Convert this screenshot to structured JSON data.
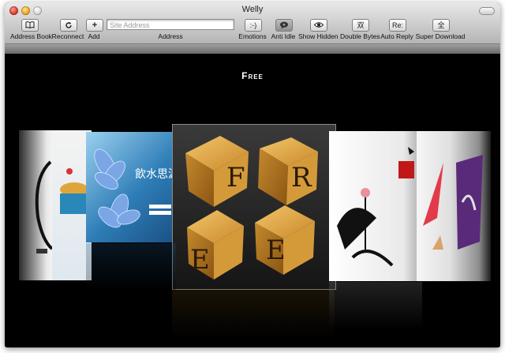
{
  "window": {
    "title": "Welly"
  },
  "toolbar": {
    "address_book": {
      "label": "Address Book",
      "icon": "book-icon"
    },
    "reconnect": {
      "label": "Reconnect",
      "icon": "reload-icon"
    },
    "add": {
      "label": "Add",
      "glyph": "+"
    },
    "address": {
      "label": "Address",
      "placeholder": "Site Address"
    },
    "emotions": {
      "label": "Emotions",
      "glyph": ":-)"
    },
    "anti_idle": {
      "label": "Anti Idle",
      "icon": "speech-bubble-icon"
    },
    "show_hidden": {
      "label": "Show Hidden",
      "icon": "eye-icon"
    },
    "double_bytes": {
      "label": "Double Bytes",
      "glyph": "双"
    },
    "auto_reply": {
      "label": "Auto Reply",
      "glyph": "Re:"
    },
    "super_download": {
      "label": "Super Download",
      "glyph": "全"
    }
  },
  "coverflow": {
    "selected_title": "Free",
    "center_cube_letters": [
      "F",
      "R",
      "E",
      "E"
    ],
    "accent_colors": {
      "cube": "#d9a23a",
      "blue_card": "#1f5f9a",
      "red_seal": "#c01818"
    }
  }
}
